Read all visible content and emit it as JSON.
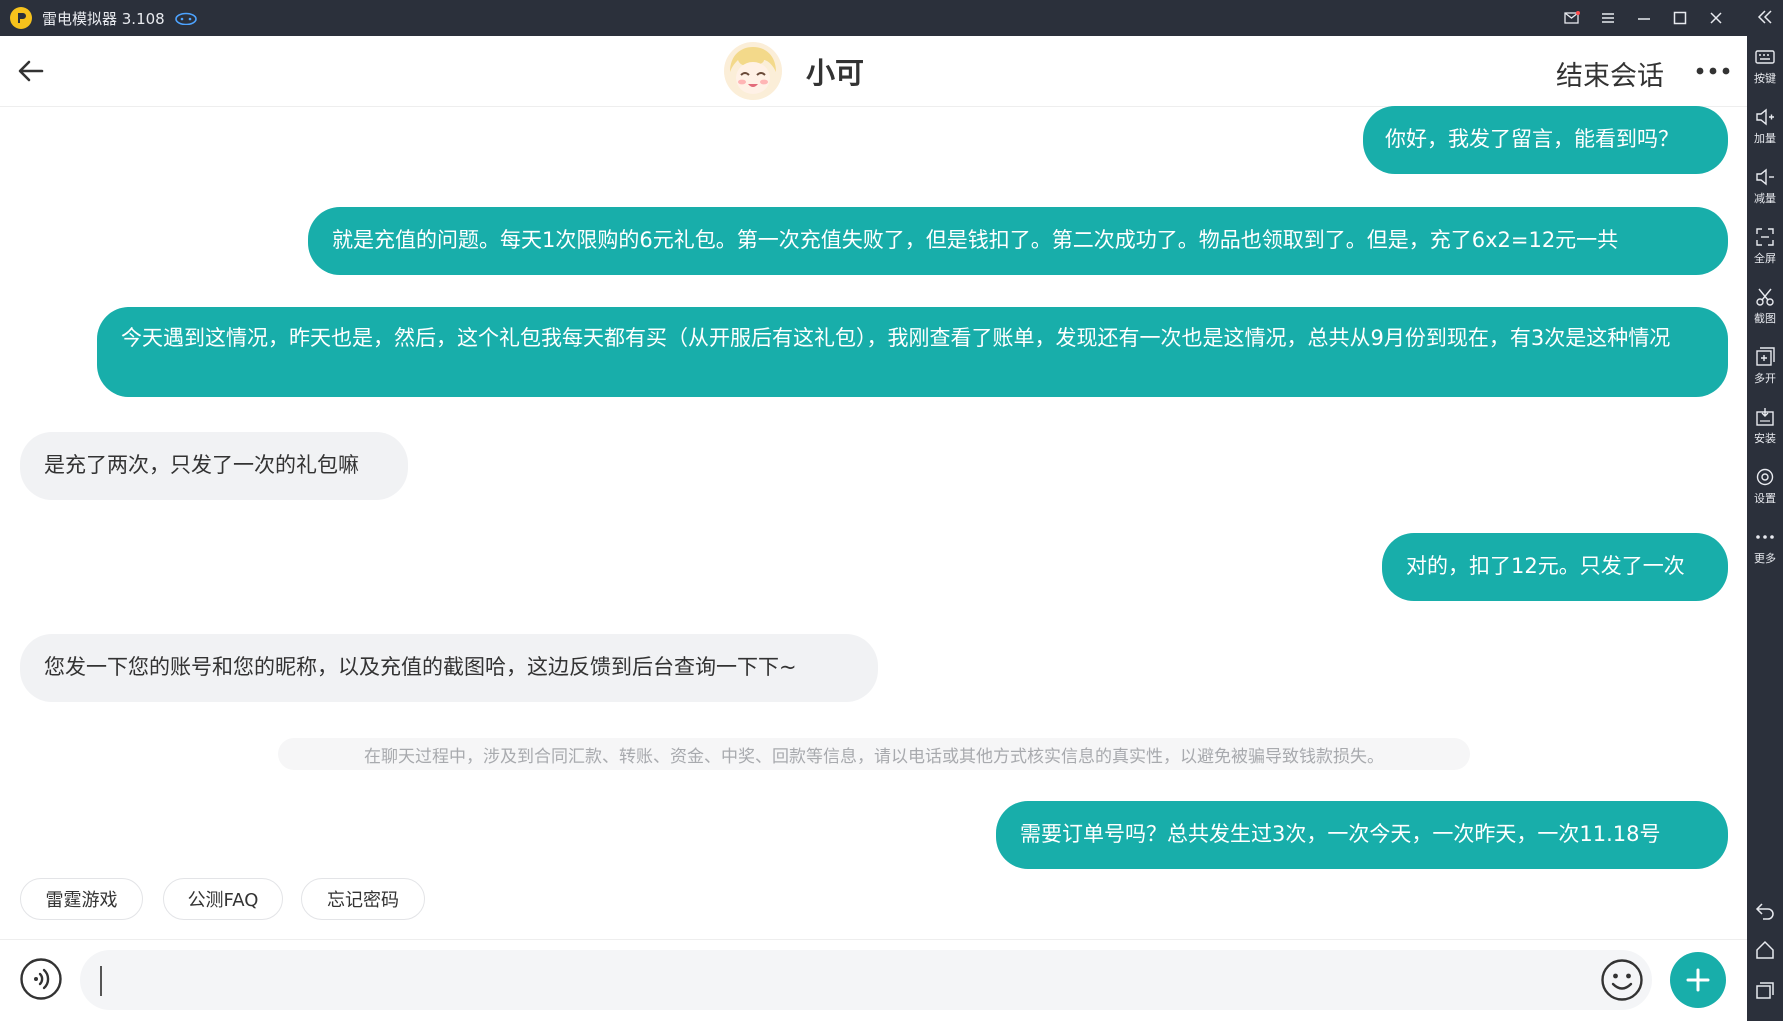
{
  "window": {
    "title": "雷电模拟器 3.108",
    "logo": "leidian-logo-icon",
    "controls": [
      "mail-icon",
      "menu-icon",
      "minimize-icon",
      "maximize-icon",
      "close-icon"
    ]
  },
  "sidebar": {
    "collapse_icon": "double-chevron-left-icon",
    "tools": [
      {
        "label": "按键",
        "icon": "keyboard-icon"
      },
      {
        "label": "加量",
        "icon": "volume-up-icon"
      },
      {
        "label": "减量",
        "icon": "volume-down-icon"
      },
      {
        "label": "全屏",
        "icon": "fullscreen-icon"
      },
      {
        "label": "截图",
        "icon": "scissors-icon"
      },
      {
        "label": "多开",
        "icon": "multi-instance-icon"
      },
      {
        "label": "安装",
        "icon": "apk-install-icon"
      },
      {
        "label": "设置",
        "icon": "gear-icon"
      },
      {
        "label": "更多",
        "icon": "more-dots-icon"
      }
    ],
    "nav": [
      "back-nav-icon",
      "home-nav-icon",
      "recent-apps-icon"
    ]
  },
  "header": {
    "peer_name": "小可",
    "end_chat": "结束会话"
  },
  "messages": [
    {
      "side": "out",
      "text": "你好，我发了留言，能看到吗？"
    },
    {
      "side": "out",
      "text": "就是充值的问题。每天1次限购的6元礼包。第一次充值失败了，但是钱扣了。第二次成功了。物品也领取到了。但是，充了6x2=12元一共"
    },
    {
      "side": "out",
      "text": "今天遇到这情况，昨天也是，然后，这个礼包我每天都有买（从开服后有这礼包），我刚查看了账单，发现还有一次也是这情况，总共从9月份到现在，有3次是这种情况"
    },
    {
      "side": "in",
      "text": "是充了两次，只发了一次的礼包嘛"
    },
    {
      "side": "out",
      "text": "对的，扣了12元。只发了一次"
    },
    {
      "side": "in",
      "text": "您发一下您的账号和您的昵称，以及充值的截图哈，这边反馈到后台查询一下下~"
    },
    {
      "side": "out",
      "text": "需要订单号吗？总共发生过3次，一次今天，一次昨天，一次11.18号"
    }
  ],
  "notice": "在聊天过程中，涉及到合同汇款、转账、资金、中奖、回款等信息，请以电话或其他方式核实信息的真实性，以避免被骗导致钱款损失。",
  "quick_replies": [
    "雷霆游戏",
    "公测FAQ",
    "忘记密码"
  ],
  "input": {
    "value": "",
    "placeholder": ""
  },
  "colors": {
    "accent": "#18aeaa",
    "incoming_bubble": "#f1f2f4",
    "emulator_bar": "#2b303b"
  }
}
